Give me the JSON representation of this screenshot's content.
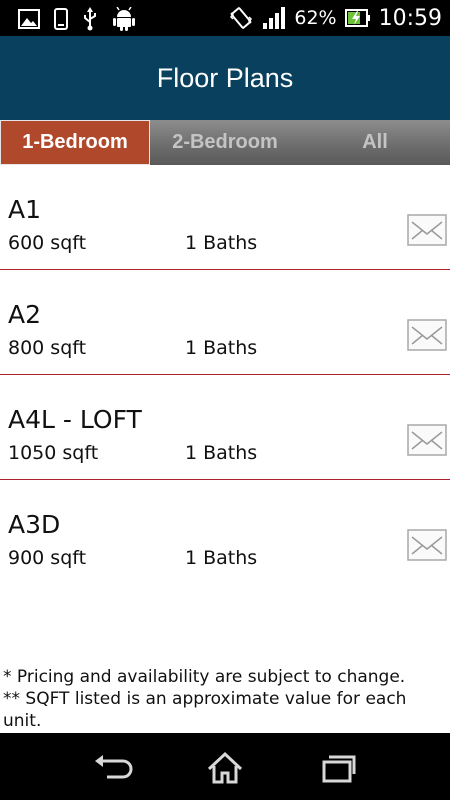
{
  "status_bar": {
    "battery": "62%",
    "time": "10:59",
    "left_icons": [
      "image-icon",
      "phone-icon",
      "usb-icon",
      "android-icon"
    ],
    "right_icons": [
      "vibrate-icon",
      "signal-icon",
      "battery-icon"
    ]
  },
  "header": {
    "title": "Floor Plans"
  },
  "tabs": [
    {
      "label": "1-Bedroom",
      "active": true
    },
    {
      "label": "2-Bedroom",
      "active": false
    },
    {
      "label": "All",
      "active": false
    }
  ],
  "plans": [
    {
      "name": "A1",
      "sqft": "600 sqft",
      "baths": "1 Baths"
    },
    {
      "name": "A2",
      "sqft": "800 sqft",
      "baths": "1 Baths"
    },
    {
      "name": "A4L - LOFT",
      "sqft": "1050 sqft",
      "baths": "1 Baths"
    },
    {
      "name": "A3D",
      "sqft": "900 sqft",
      "baths": "1 Baths"
    }
  ],
  "notes": {
    "line1": "* Pricing and availability are subject to change.",
    "line2": "** SQFT listed is an approximate value for each unit."
  },
  "nav_bar": {
    "icons": [
      "back-icon",
      "home-icon",
      "recent-apps-icon"
    ]
  },
  "colors": {
    "header_bg": "#08405e",
    "active_tab": "#b0492c",
    "divider": "#b0202c"
  }
}
